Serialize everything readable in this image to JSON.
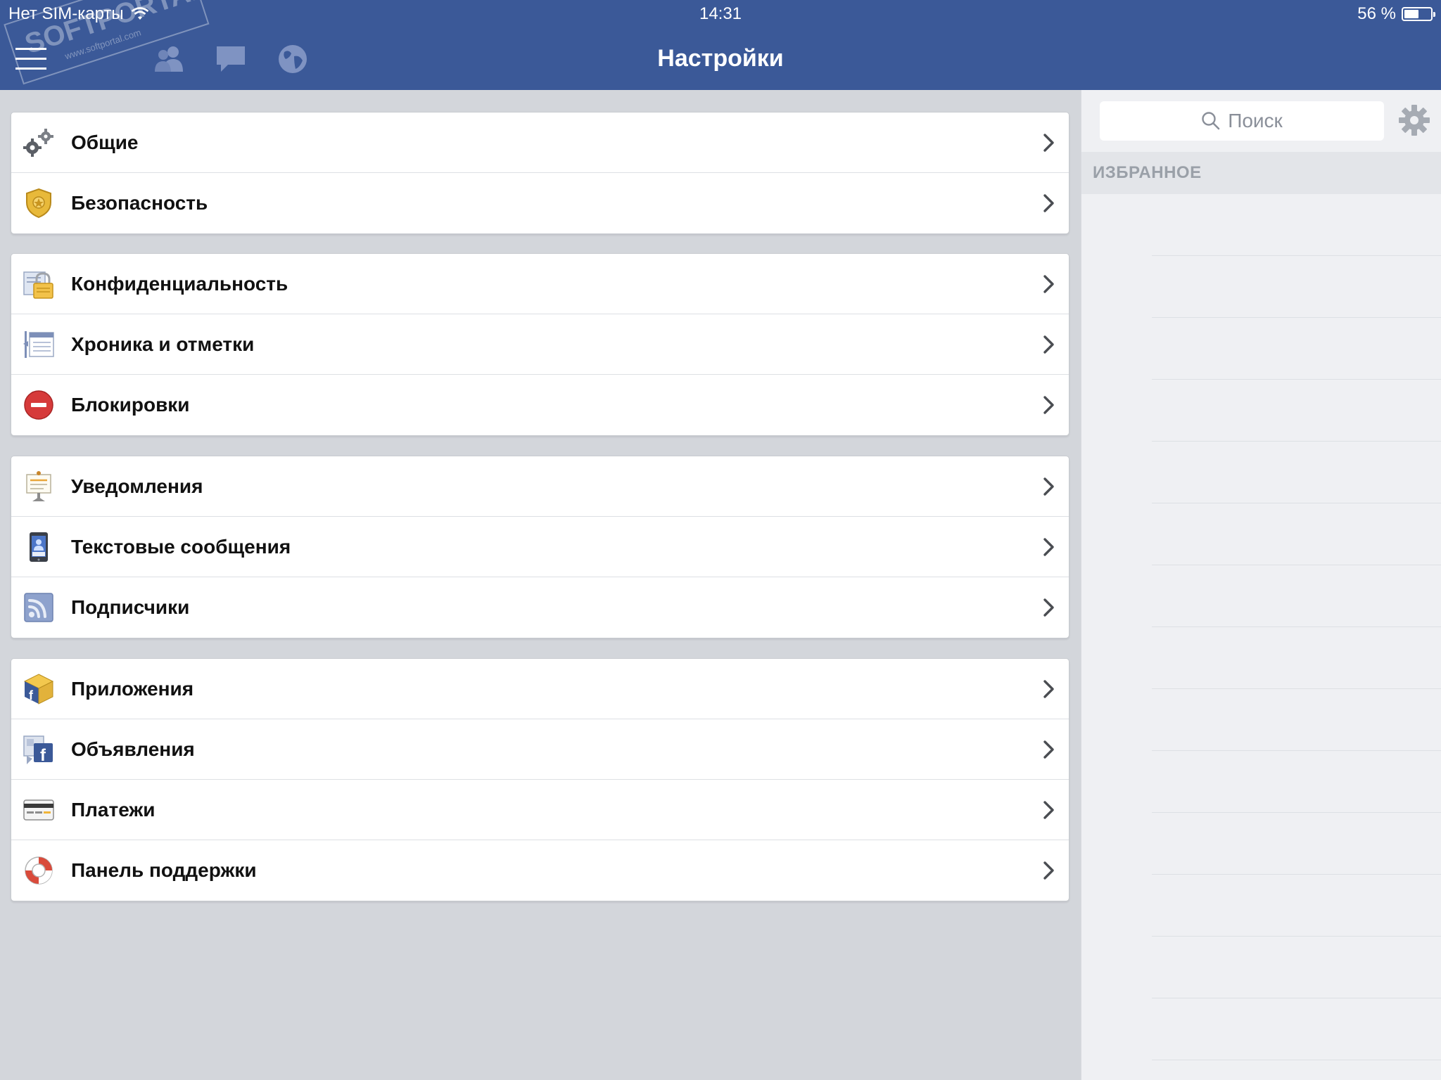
{
  "status_bar": {
    "carrier": "Нет SIM-карты",
    "time": "14:31",
    "battery_text": "56 %",
    "battery_level": 0.56
  },
  "nav": {
    "title": "Настройки",
    "menu_icon": "hamburger-icon",
    "friends_icon": "friends-icon",
    "messages_icon": "chat-bubble-icon",
    "globe_icon": "globe-icon"
  },
  "settings": {
    "groups": [
      [
        {
          "label": "Общие",
          "icon": "gears-icon"
        },
        {
          "label": "Безопасность",
          "icon": "security-badge-icon"
        }
      ],
      [
        {
          "label": "Конфиденциальность",
          "icon": "privacy-lock-icon"
        },
        {
          "label": "Хроника и отметки",
          "icon": "timeline-icon"
        },
        {
          "label": "Блокировки",
          "icon": "block-icon"
        }
      ],
      [
        {
          "label": "Уведомления",
          "icon": "notifications-icon"
        },
        {
          "label": "Текстовые сообщения",
          "icon": "mobile-phone-icon"
        },
        {
          "label": "Подписчики",
          "icon": "rss-icon"
        }
      ],
      [
        {
          "label": "Приложения",
          "icon": "apps-box-icon"
        },
        {
          "label": "Объявления",
          "icon": "ads-icon"
        },
        {
          "label": "Платежи",
          "icon": "credit-card-icon"
        },
        {
          "label": "Панель поддержки",
          "icon": "lifebuoy-icon"
        }
      ]
    ]
  },
  "right_panel": {
    "search_placeholder": "Поиск",
    "favorites_header": "ИЗБРАННОЕ"
  },
  "colors": {
    "brand": "#3b5998",
    "background": "#d3d6db",
    "panel": "#eff0f3"
  }
}
